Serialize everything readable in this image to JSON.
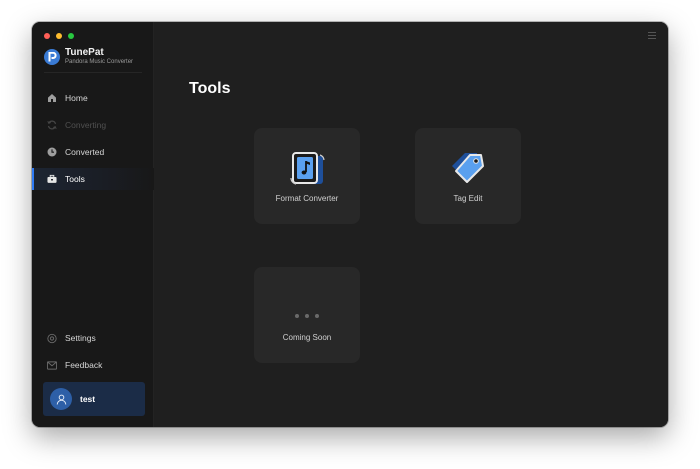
{
  "app": {
    "name": "TunePat",
    "subtitle": "Pandora Music Converter"
  },
  "sidebar": {
    "items": [
      {
        "label": "Home",
        "icon": "home-icon",
        "state": "normal"
      },
      {
        "label": "Converting",
        "icon": "converting-icon",
        "state": "disabled"
      },
      {
        "label": "Converted",
        "icon": "clock-icon",
        "state": "normal"
      },
      {
        "label": "Tools",
        "icon": "toolbox-icon",
        "state": "active"
      }
    ],
    "bottom_items": [
      {
        "label": "Settings",
        "icon": "gear-icon"
      },
      {
        "label": "Feedback",
        "icon": "mail-icon"
      }
    ],
    "user": {
      "name": "test"
    }
  },
  "main": {
    "title": "Tools",
    "tools": [
      {
        "label": "Format Converter",
        "icon": "format-converter-icon"
      },
      {
        "label": "Tag Edit",
        "icon": "tag-icon"
      },
      {
        "label": "Coming Soon",
        "icon": "more-dots-icon"
      }
    ]
  },
  "colors": {
    "accent": "#2f7bf6",
    "sidebar_bg": "#181818",
    "main_bg": "#1f1f1f",
    "card_bg": "#282828",
    "user_card_bg": "#1b2c47"
  }
}
